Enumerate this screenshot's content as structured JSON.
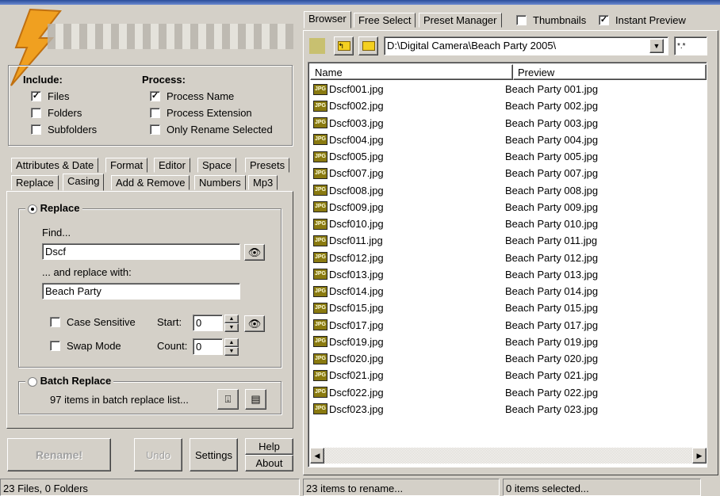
{
  "include": {
    "title": "Include:",
    "items": [
      {
        "label": "Files",
        "checked": true
      },
      {
        "label": "Folders",
        "checked": false
      },
      {
        "label": "Subfolders",
        "checked": false
      }
    ]
  },
  "process": {
    "title": "Process:",
    "items": [
      {
        "label": "Process Name",
        "checked": true
      },
      {
        "label": "Process Extension",
        "checked": false
      },
      {
        "label": "Only Rename Selected",
        "checked": false
      }
    ]
  },
  "tabs_row1": [
    "Attributes & Date",
    "Format",
    "Editor",
    "Space",
    "Presets"
  ],
  "tabs_row2": [
    "Replace",
    "Casing",
    "Add & Remove",
    "Numbers",
    "Mp3"
  ],
  "replace": {
    "title": "Replace",
    "find_label": "Find...",
    "find_value": "Dscf",
    "replace_label": "... and replace with:",
    "replace_value": "Beach Party",
    "case_sensitive": "Case Sensitive",
    "swap_mode": "Swap Mode",
    "start_label": "Start:",
    "start_value": "0",
    "count_label": "Count:",
    "count_value": "0"
  },
  "batch": {
    "title": "Batch Replace",
    "info": "97 items in batch replace list..."
  },
  "buttons": {
    "rename": "Rename!",
    "undo": "Undo",
    "settings": "Settings",
    "help": "Help",
    "about": "About"
  },
  "right_tabs": [
    "Browser",
    "Free Select",
    "Preset Manager"
  ],
  "thumbnails": {
    "label": "Thumbnails",
    "checked": false
  },
  "instant_preview": {
    "label": "Instant Preview",
    "checked": true
  },
  "path": "D:\\Digital Camera\\Beach Party 2005\\",
  "filter": "*.*",
  "columns": {
    "name": "Name",
    "preview": "Preview"
  },
  "files": [
    {
      "name": "Dscf001.jpg",
      "preview": "Beach Party 001.jpg"
    },
    {
      "name": "Dscf002.jpg",
      "preview": "Beach Party 002.jpg"
    },
    {
      "name": "Dscf003.jpg",
      "preview": "Beach Party 003.jpg"
    },
    {
      "name": "Dscf004.jpg",
      "preview": "Beach Party 004.jpg"
    },
    {
      "name": "Dscf005.jpg",
      "preview": "Beach Party 005.jpg"
    },
    {
      "name": "Dscf007.jpg",
      "preview": "Beach Party 007.jpg"
    },
    {
      "name": "Dscf008.jpg",
      "preview": "Beach Party 008.jpg"
    },
    {
      "name": "Dscf009.jpg",
      "preview": "Beach Party 009.jpg"
    },
    {
      "name": "Dscf010.jpg",
      "preview": "Beach Party 010.jpg"
    },
    {
      "name": "Dscf011.jpg",
      "preview": "Beach Party 011.jpg"
    },
    {
      "name": "Dscf012.jpg",
      "preview": "Beach Party 012.jpg"
    },
    {
      "name": "Dscf013.jpg",
      "preview": "Beach Party 013.jpg"
    },
    {
      "name": "Dscf014.jpg",
      "preview": "Beach Party 014.jpg"
    },
    {
      "name": "Dscf015.jpg",
      "preview": "Beach Party 015.jpg"
    },
    {
      "name": "Dscf017.jpg",
      "preview": "Beach Party 017.jpg"
    },
    {
      "name": "Dscf019.jpg",
      "preview": "Beach Party 019.jpg"
    },
    {
      "name": "Dscf020.jpg",
      "preview": "Beach Party 020.jpg"
    },
    {
      "name": "Dscf021.jpg",
      "preview": "Beach Party 021.jpg"
    },
    {
      "name": "Dscf022.jpg",
      "preview": "Beach Party 022.jpg"
    },
    {
      "name": "Dscf023.jpg",
      "preview": "Beach Party 023.jpg"
    }
  ],
  "status": {
    "files": "23 Files, 0 Folders",
    "to_rename": "23 items to rename...",
    "selected": "0 items selected..."
  }
}
